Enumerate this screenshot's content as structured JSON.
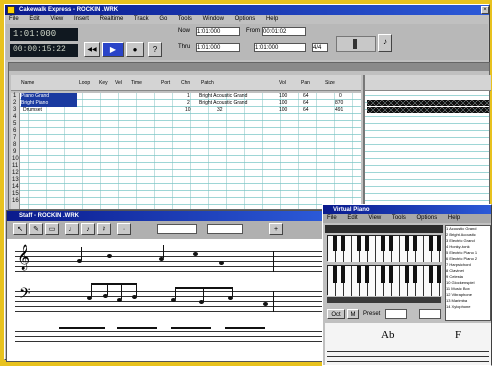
{
  "main_window": {
    "title": "Cakewalk Express - ROCKIN .WRK",
    "menu": [
      "File",
      "Edit",
      "View",
      "Insert",
      "Realtime",
      "Track",
      "Go",
      "Tools",
      "Window",
      "Options",
      "Help"
    ]
  },
  "transport": {
    "counter_1": "1:01:000",
    "counter_2": "00:00:15:22",
    "now_label": "Now",
    "now_value": "1:01:000",
    "from_label": "From",
    "from_value": "00:01:02",
    "thru_label": "Thru",
    "thru_value": "1:01:000",
    "tempo": "1:01:000",
    "meter": "4/4",
    "play_symbol": "▶",
    "record_symbol": "●",
    "rewind_symbol": "◀◀",
    "help_symbol": "?"
  },
  "track_window": {
    "columns": [
      "Name",
      "Loop",
      "Key",
      "Vel",
      "Time",
      "Port",
      "Chn",
      "Patch",
      "Vol",
      "Pan",
      "Size"
    ],
    "tracks": [
      {
        "num": "1",
        "name": "Piano Grand",
        "chn": "1",
        "patch": "Bright Acoustic Grand",
        "vol": "100",
        "pan": "64",
        "size": "0"
      },
      {
        "num": "2",
        "name": "Bright Piano",
        "chn": "2",
        "patch": "Bright Acoustic Grand",
        "vol": "100",
        "pan": "64",
        "size": "870"
      },
      {
        "num": "3",
        "name": "Drumset",
        "chn": "10",
        "patch": "32",
        "vol": "100",
        "pan": "64",
        "size": "491"
      }
    ],
    "row_numbers": [
      "1",
      "2",
      "3",
      "4",
      "5",
      "6",
      "7",
      "8",
      "9",
      "10",
      "11",
      "12",
      "13",
      "14",
      "15",
      "16"
    ]
  },
  "staff_window": {
    "title": "Staff - ROCKIN .WRK",
    "chord_label": "Ab",
    "chord_label_2": "F"
  },
  "keyboard_window": {
    "title": "Virtual Piano",
    "menu": [
      "File",
      "Edit",
      "View",
      "Tools",
      "Options",
      "Help"
    ],
    "octave_label": "Oct",
    "preset_label": "Preset",
    "list_items": [
      "1 Acoustic Grand",
      "2 Bright Acoustic",
      "3 Electric Grand",
      "4 Honky-tonk",
      "5 Electric Piano 1",
      "6 Electric Piano 2",
      "7 Harpsichord",
      "8 Clavinet",
      "9 Celesta",
      "10 Glockenspiel",
      "11 Music Box",
      "12 Vibraphone",
      "13 Marimba",
      "14 Xylophone"
    ]
  },
  "colors": {
    "background": "#e8c21e",
    "titlebar": "#0a1a8c",
    "selection": "#1a3aa0"
  }
}
